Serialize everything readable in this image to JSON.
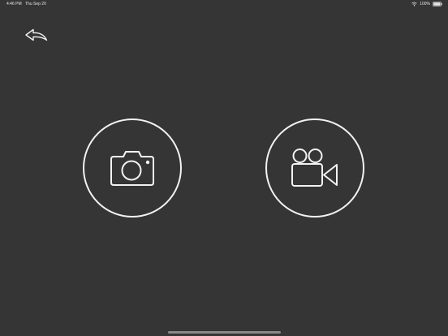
{
  "status_bar": {
    "time": "4:46 PM",
    "date": "Thu Sep 20",
    "battery_percent": "100%",
    "wifi_icon": "wifi-icon",
    "battery_icon": "battery-icon"
  },
  "navigation": {
    "back_icon": "back-arrow-icon"
  },
  "capture_options": [
    {
      "name": "photo",
      "icon": "camera-icon"
    },
    {
      "name": "video",
      "icon": "video-camera-icon"
    }
  ],
  "colors": {
    "background": "#353535",
    "foreground": "#f2f2f2",
    "home_indicator": "#8a8a8a"
  }
}
